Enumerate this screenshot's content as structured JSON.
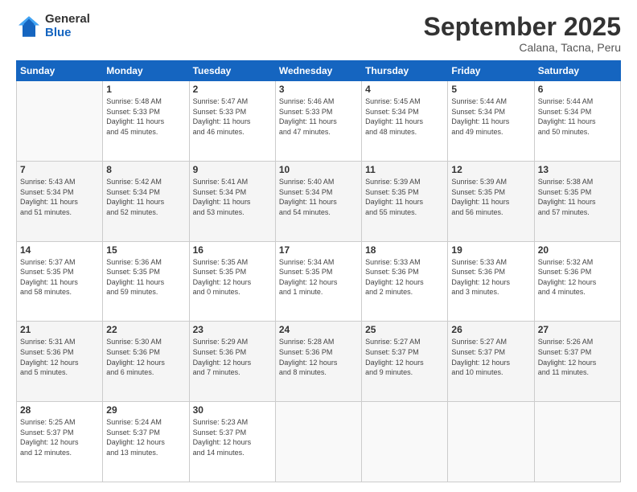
{
  "logo": {
    "general": "General",
    "blue": "Blue"
  },
  "header": {
    "month": "September 2025",
    "location": "Calana, Tacna, Peru"
  },
  "weekdays": [
    "Sunday",
    "Monday",
    "Tuesday",
    "Wednesday",
    "Thursday",
    "Friday",
    "Saturday"
  ],
  "weeks": [
    [
      {
        "day": "",
        "info": ""
      },
      {
        "day": "1",
        "info": "Sunrise: 5:48 AM\nSunset: 5:33 PM\nDaylight: 11 hours\nand 45 minutes."
      },
      {
        "day": "2",
        "info": "Sunrise: 5:47 AM\nSunset: 5:33 PM\nDaylight: 11 hours\nand 46 minutes."
      },
      {
        "day": "3",
        "info": "Sunrise: 5:46 AM\nSunset: 5:33 PM\nDaylight: 11 hours\nand 47 minutes."
      },
      {
        "day": "4",
        "info": "Sunrise: 5:45 AM\nSunset: 5:34 PM\nDaylight: 11 hours\nand 48 minutes."
      },
      {
        "day": "5",
        "info": "Sunrise: 5:44 AM\nSunset: 5:34 PM\nDaylight: 11 hours\nand 49 minutes."
      },
      {
        "day": "6",
        "info": "Sunrise: 5:44 AM\nSunset: 5:34 PM\nDaylight: 11 hours\nand 50 minutes."
      }
    ],
    [
      {
        "day": "7",
        "info": "Sunrise: 5:43 AM\nSunset: 5:34 PM\nDaylight: 11 hours\nand 51 minutes."
      },
      {
        "day": "8",
        "info": "Sunrise: 5:42 AM\nSunset: 5:34 PM\nDaylight: 11 hours\nand 52 minutes."
      },
      {
        "day": "9",
        "info": "Sunrise: 5:41 AM\nSunset: 5:34 PM\nDaylight: 11 hours\nand 53 minutes."
      },
      {
        "day": "10",
        "info": "Sunrise: 5:40 AM\nSunset: 5:34 PM\nDaylight: 11 hours\nand 54 minutes."
      },
      {
        "day": "11",
        "info": "Sunrise: 5:39 AM\nSunset: 5:35 PM\nDaylight: 11 hours\nand 55 minutes."
      },
      {
        "day": "12",
        "info": "Sunrise: 5:39 AM\nSunset: 5:35 PM\nDaylight: 11 hours\nand 56 minutes."
      },
      {
        "day": "13",
        "info": "Sunrise: 5:38 AM\nSunset: 5:35 PM\nDaylight: 11 hours\nand 57 minutes."
      }
    ],
    [
      {
        "day": "14",
        "info": "Sunrise: 5:37 AM\nSunset: 5:35 PM\nDaylight: 11 hours\nand 58 minutes."
      },
      {
        "day": "15",
        "info": "Sunrise: 5:36 AM\nSunset: 5:35 PM\nDaylight: 11 hours\nand 59 minutes."
      },
      {
        "day": "16",
        "info": "Sunrise: 5:35 AM\nSunset: 5:35 PM\nDaylight: 12 hours\nand 0 minutes."
      },
      {
        "day": "17",
        "info": "Sunrise: 5:34 AM\nSunset: 5:35 PM\nDaylight: 12 hours\nand 1 minute."
      },
      {
        "day": "18",
        "info": "Sunrise: 5:33 AM\nSunset: 5:36 PM\nDaylight: 12 hours\nand 2 minutes."
      },
      {
        "day": "19",
        "info": "Sunrise: 5:33 AM\nSunset: 5:36 PM\nDaylight: 12 hours\nand 3 minutes."
      },
      {
        "day": "20",
        "info": "Sunrise: 5:32 AM\nSunset: 5:36 PM\nDaylight: 12 hours\nand 4 minutes."
      }
    ],
    [
      {
        "day": "21",
        "info": "Sunrise: 5:31 AM\nSunset: 5:36 PM\nDaylight: 12 hours\nand 5 minutes."
      },
      {
        "day": "22",
        "info": "Sunrise: 5:30 AM\nSunset: 5:36 PM\nDaylight: 12 hours\nand 6 minutes."
      },
      {
        "day": "23",
        "info": "Sunrise: 5:29 AM\nSunset: 5:36 PM\nDaylight: 12 hours\nand 7 minutes."
      },
      {
        "day": "24",
        "info": "Sunrise: 5:28 AM\nSunset: 5:36 PM\nDaylight: 12 hours\nand 8 minutes."
      },
      {
        "day": "25",
        "info": "Sunrise: 5:27 AM\nSunset: 5:37 PM\nDaylight: 12 hours\nand 9 minutes."
      },
      {
        "day": "26",
        "info": "Sunrise: 5:27 AM\nSunset: 5:37 PM\nDaylight: 12 hours\nand 10 minutes."
      },
      {
        "day": "27",
        "info": "Sunrise: 5:26 AM\nSunset: 5:37 PM\nDaylight: 12 hours\nand 11 minutes."
      }
    ],
    [
      {
        "day": "28",
        "info": "Sunrise: 5:25 AM\nSunset: 5:37 PM\nDaylight: 12 hours\nand 12 minutes."
      },
      {
        "day": "29",
        "info": "Sunrise: 5:24 AM\nSunset: 5:37 PM\nDaylight: 12 hours\nand 13 minutes."
      },
      {
        "day": "30",
        "info": "Sunrise: 5:23 AM\nSunset: 5:37 PM\nDaylight: 12 hours\nand 14 minutes."
      },
      {
        "day": "",
        "info": ""
      },
      {
        "day": "",
        "info": ""
      },
      {
        "day": "",
        "info": ""
      },
      {
        "day": "",
        "info": ""
      }
    ]
  ]
}
